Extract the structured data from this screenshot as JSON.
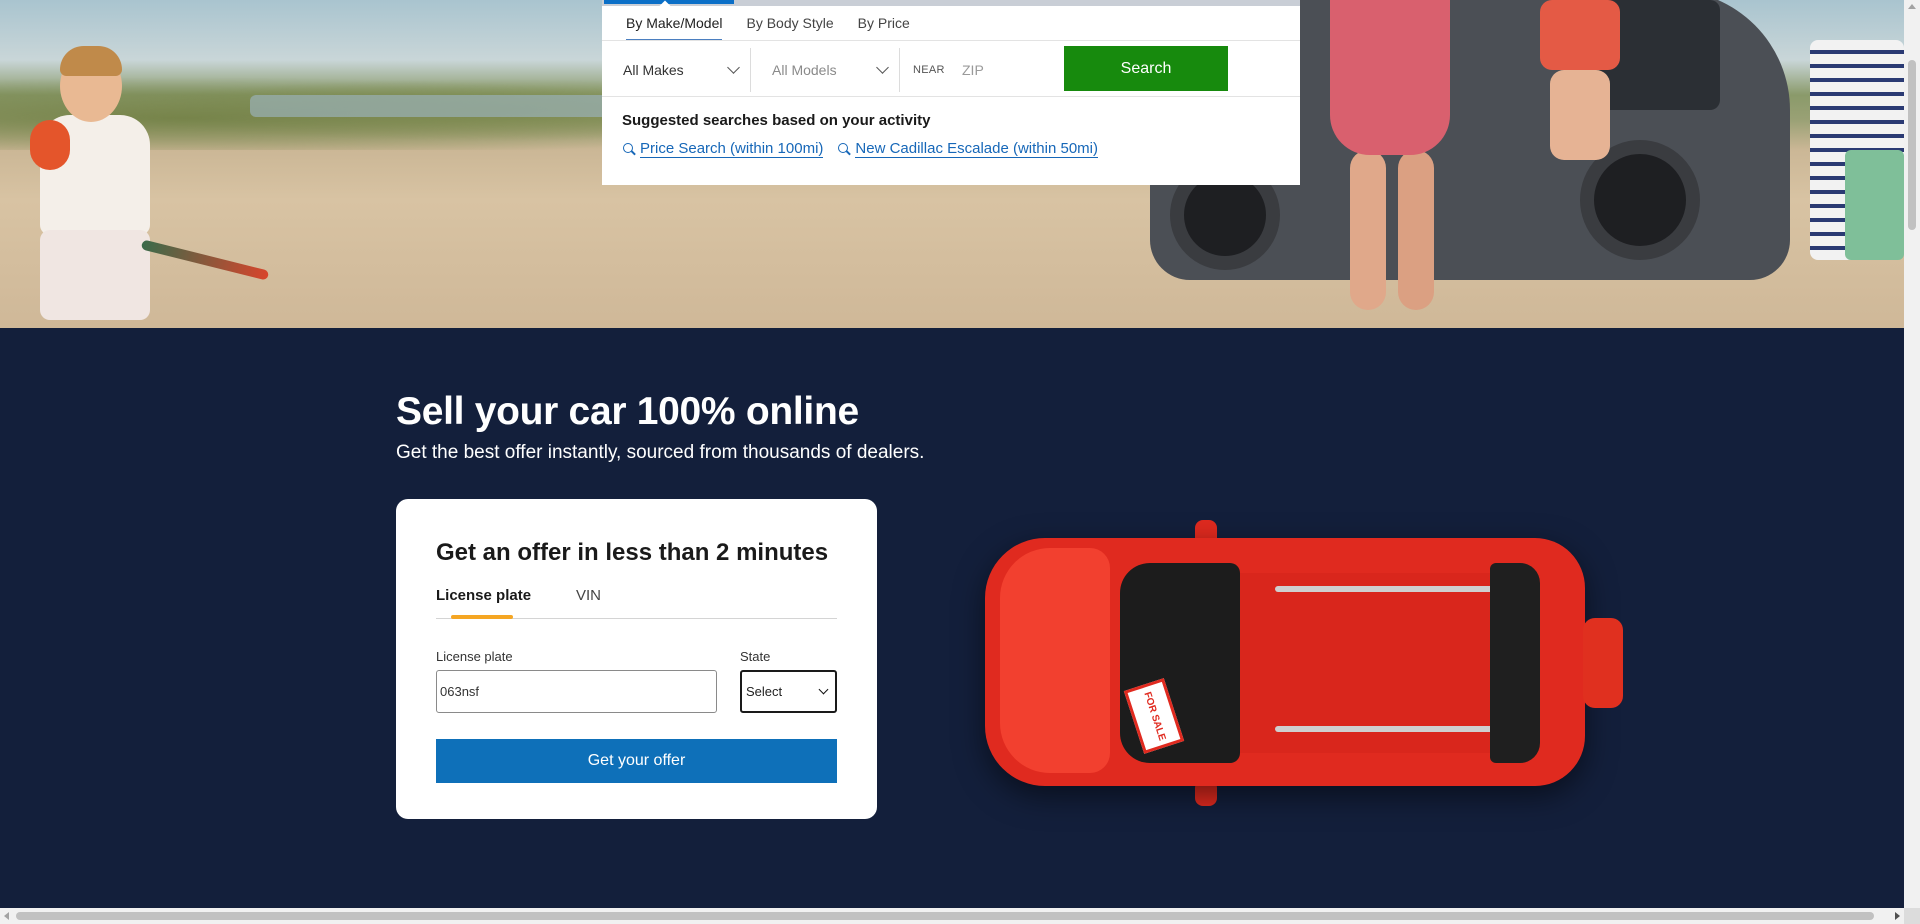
{
  "search": {
    "tabs": [
      "By Make/Model",
      "By Body Style",
      "By Price"
    ],
    "make_select": "All Makes",
    "model_select": "All Models",
    "near_label": "NEAR",
    "zip_placeholder": "ZIP",
    "search_button": "Search",
    "suggested_title": "Suggested searches based on your activity",
    "suggestions": [
      "Price Search (within 100mi)",
      "New Cadillac Escalade (within 50mi)"
    ]
  },
  "sell": {
    "title": "Sell your car 100% online",
    "subtitle": "Get the best offer instantly, sourced from thousands of dealers.",
    "card_title": "Get an offer in less than 2 minutes",
    "tabs": [
      "License plate",
      "VIN"
    ],
    "plate_label": "License plate",
    "plate_value": "063nsf",
    "state_label": "State",
    "state_select": "Select",
    "offer_button": "Get your offer",
    "car_sign": "FOR SALE"
  },
  "colors": {
    "search_button": "#178a0d",
    "offer_button": "#0e70b9",
    "section_bg": "#131f3b",
    "tab_accent": "#f5a623",
    "link": "#1667b8"
  }
}
